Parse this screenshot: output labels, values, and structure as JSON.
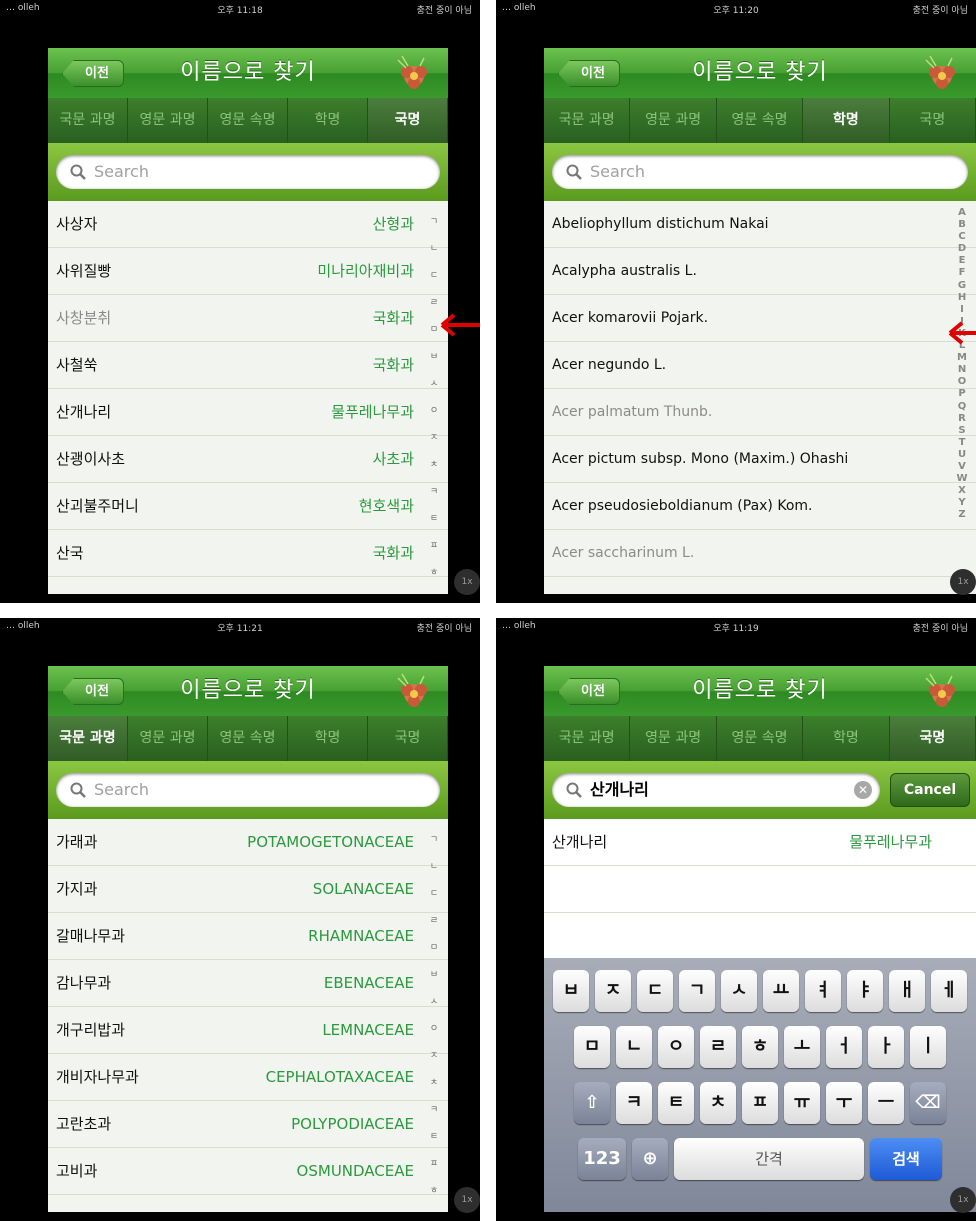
{
  "colors": {
    "header_green": "#47a033",
    "family_green": "#2b9a3f",
    "arrow_red": "#e00000"
  },
  "common": {
    "carrier": "… olleh",
    "charging": "충전 중이 아님",
    "back_label": "이전",
    "title": "이름으로 찾기",
    "search_placeholder": "Search",
    "zoom": "1x",
    "tabs": [
      "국문 과명",
      "영문 과명",
      "영문 속명",
      "학명",
      "국명"
    ]
  },
  "panel1": {
    "time": "오후 11:18",
    "rows": [
      {
        "name": "사상자",
        "family": "산형과"
      },
      {
        "name": "사위질빵",
        "family": "미나리아재비과"
      },
      {
        "name": "사창분취",
        "family": "국화과"
      },
      {
        "name": "사철쑥",
        "family": "국화과"
      },
      {
        "name": "산개나리",
        "family": "물푸레나무과"
      },
      {
        "name": "산괭이사초",
        "family": "사초과"
      },
      {
        "name": "산괴불주머니",
        "family": "현호색과"
      },
      {
        "name": "산국",
        "family": "국화과"
      }
    ],
    "index": [
      "ㄱ",
      "ㄴ",
      "ㄷ",
      "ㄹ",
      "ㅁ",
      "ㅂ",
      "ㅅ",
      "ㅇ",
      "ㅈ",
      "ㅊ",
      "ㅋ",
      "ㅌ",
      "ㅍ",
      "ㅎ"
    ]
  },
  "panel2": {
    "time": "오후 11:20",
    "rows": [
      {
        "name": "Abeliophyllum distichum Nakai"
      },
      {
        "name": "Acalypha australis L."
      },
      {
        "name": "Acer komarovii Pojark."
      },
      {
        "name": "Acer negundo L."
      },
      {
        "name": "Acer palmatum Thunb."
      },
      {
        "name": "Acer pictum subsp. Mono (Maxim.) Ohashi"
      },
      {
        "name": "Acer pseudosieboldianum (Pax) Kom."
      },
      {
        "name": "Acer saccharinum L."
      }
    ],
    "index": [
      "A",
      "B",
      "C",
      "D",
      "E",
      "F",
      "G",
      "H",
      "I",
      "J",
      "K",
      "L",
      "M",
      "N",
      "O",
      "P",
      "Q",
      "R",
      "S",
      "T",
      "U",
      "V",
      "W",
      "X",
      "Y",
      "Z"
    ]
  },
  "panel3": {
    "time": "오후 11:21",
    "rows": [
      {
        "name": "가래과",
        "family": "POTAMOGETONACEAE"
      },
      {
        "name": "가지과",
        "family": "SOLANACEAE"
      },
      {
        "name": "갈매나무과",
        "family": "RHAMNACEAE"
      },
      {
        "name": "감나무과",
        "family": "EBENACEAE"
      },
      {
        "name": "개구리밥과",
        "family": "LEMNACEAE"
      },
      {
        "name": "개비자나무과",
        "family": "CEPHALOTAXACEAE"
      },
      {
        "name": "고란초과",
        "family": "POLYPODIACEAE"
      },
      {
        "name": "고비과",
        "family": "OSMUNDACEAE"
      }
    ]
  },
  "panel4": {
    "time": "오후 11:19",
    "search_value": "산개나리",
    "cancel_label": "Cancel",
    "rows": [
      {
        "name": "산개나리",
        "family": "물푸레나무과"
      }
    ],
    "keyboard": {
      "row1": [
        "ㅂ",
        "ㅈ",
        "ㄷ",
        "ㄱ",
        "ㅅ",
        "ㅛ",
        "ㅕ",
        "ㅑ",
        "ㅐ",
        "ㅔ"
      ],
      "row2": [
        "ㅁ",
        "ㄴ",
        "ㅇ",
        "ㄹ",
        "ㅎ",
        "ㅗ",
        "ㅓ",
        "ㅏ",
        "ㅣ"
      ],
      "row3": [
        "ㅋ",
        "ㅌ",
        "ㅊ",
        "ㅍ",
        "ㅠ",
        "ㅜ",
        "ㅡ"
      ],
      "numbers_label": "123",
      "space_label": "간격",
      "search_label": "검색"
    }
  }
}
